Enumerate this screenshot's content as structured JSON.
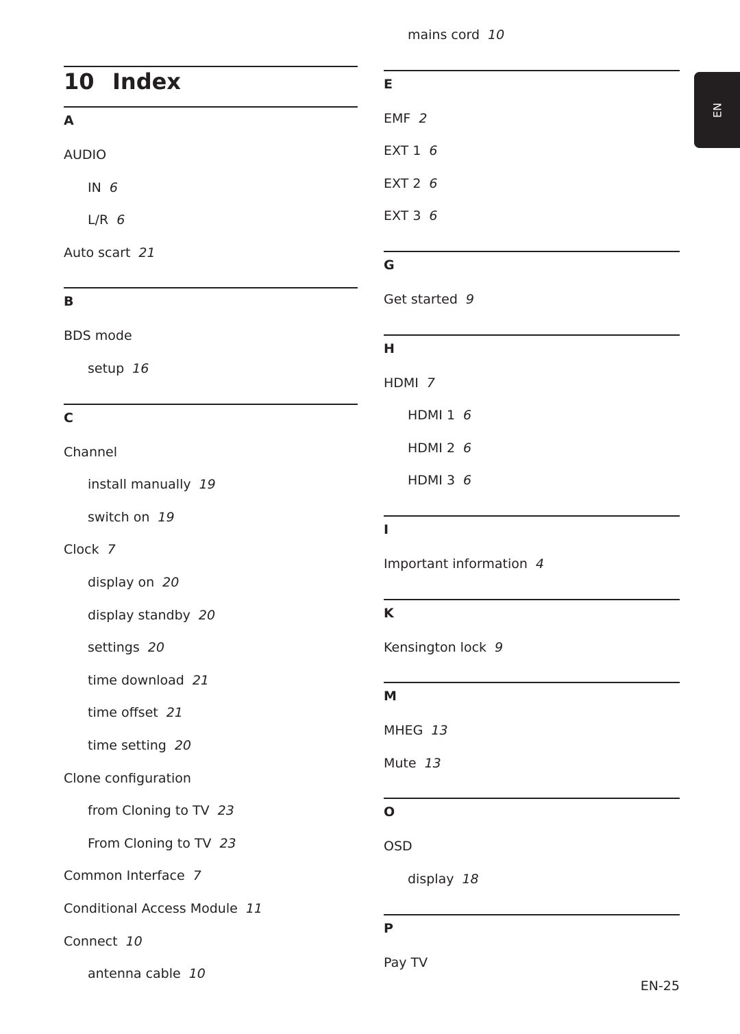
{
  "header": {
    "chapter_number": "10",
    "title": "Index"
  },
  "language_tab": "EN",
  "page_number": "EN-25",
  "left_column": [
    {
      "letter": "A",
      "entries": [
        {
          "term": "AUDIO",
          "page": "",
          "level": 0
        },
        {
          "term": "IN",
          "page": "6",
          "level": 1
        },
        {
          "term": "L/R",
          "page": "6",
          "level": 1
        },
        {
          "term": "Auto scart",
          "page": "21",
          "level": 0
        }
      ]
    },
    {
      "letter": "B",
      "entries": [
        {
          "term": "BDS mode",
          "page": "",
          "level": 0
        },
        {
          "term": "setup",
          "page": "16",
          "level": 1
        }
      ]
    },
    {
      "letter": "C",
      "entries": [
        {
          "term": "Channel",
          "page": "",
          "level": 0
        },
        {
          "term": "install manually",
          "page": "19",
          "level": 1
        },
        {
          "term": "switch on",
          "page": "19",
          "level": 1
        },
        {
          "term": "Clock",
          "page": "7",
          "level": 0
        },
        {
          "term": "display on",
          "page": "20",
          "level": 1
        },
        {
          "term": "display standby",
          "page": "20",
          "level": 1
        },
        {
          "term": "settings",
          "page": "20",
          "level": 1
        },
        {
          "term": "time download",
          "page": "21",
          "level": 1
        },
        {
          "term": "time offset",
          "page": "21",
          "level": 1
        },
        {
          "term": "time setting",
          "page": "20",
          "level": 1
        },
        {
          "term": "Clone configuration",
          "page": "",
          "level": 0
        },
        {
          "term": "from Cloning to TV",
          "page": "23",
          "level": 1
        },
        {
          "term": "From Cloning to TV",
          "page": "23",
          "level": 1
        },
        {
          "term": "Common Interface",
          "page": "7",
          "level": 0
        },
        {
          "term": "Conditional Access Module",
          "page": "11",
          "level": 0
        },
        {
          "term": "Connect",
          "page": "10",
          "level": 0
        },
        {
          "term": "antenna cable",
          "page": "10",
          "level": 1
        }
      ]
    }
  ],
  "right_column": [
    {
      "letter": "",
      "entries": [
        {
          "term": "mains cord",
          "page": "10",
          "level": 1
        }
      ]
    },
    {
      "letter": "E",
      "entries": [
        {
          "term": "EMF",
          "page": "2",
          "level": 0
        },
        {
          "term": "EXT 1",
          "page": "6",
          "level": 0
        },
        {
          "term": "EXT 2",
          "page": "6",
          "level": 0
        },
        {
          "term": "EXT 3",
          "page": "6",
          "level": 0
        }
      ]
    },
    {
      "letter": "G",
      "entries": [
        {
          "term": "Get started",
          "page": "9",
          "level": 0
        }
      ]
    },
    {
      "letter": "H",
      "entries": [
        {
          "term": "HDMI",
          "page": "7",
          "level": 0
        },
        {
          "term": "HDMI 1",
          "page": "6",
          "level": 1
        },
        {
          "term": "HDMI 2",
          "page": "6",
          "level": 1
        },
        {
          "term": "HDMI 3",
          "page": "6",
          "level": 1
        }
      ]
    },
    {
      "letter": "I",
      "entries": [
        {
          "term": "Important information",
          "page": "4",
          "level": 0
        }
      ]
    },
    {
      "letter": "K",
      "entries": [
        {
          "term": "Kensington lock",
          "page": "9",
          "level": 0
        }
      ]
    },
    {
      "letter": "M",
      "entries": [
        {
          "term": "MHEG",
          "page": "13",
          "level": 0
        },
        {
          "term": "Mute",
          "page": "13",
          "level": 0
        }
      ]
    },
    {
      "letter": "O",
      "entries": [
        {
          "term": "OSD",
          "page": "",
          "level": 0
        },
        {
          "term": "display",
          "page": "18",
          "level": 1
        }
      ]
    },
    {
      "letter": "P",
      "entries": [
        {
          "term": "Pay TV",
          "page": "",
          "level": 0
        }
      ]
    }
  ]
}
